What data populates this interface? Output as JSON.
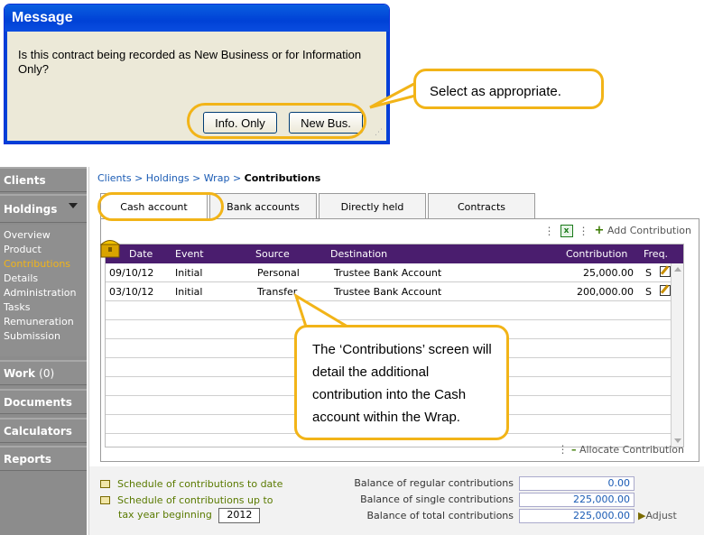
{
  "dialog": {
    "title": "Message",
    "text": "Is this contract being recorded as New Business or for Information Only?",
    "btn_info": "Info. Only",
    "btn_new": "New Bus."
  },
  "callout_top": "Select as appropriate.",
  "callout_mid": "The ‘Contributions’ screen will detail the additional contribution into the Cash account within the Wrap.",
  "nav": {
    "clients": "Clients",
    "holdings": "Holdings",
    "sub": [
      "Overview",
      "Product",
      "Contributions",
      "Details",
      "Administration",
      "Tasks",
      "Remuneration",
      "Submission"
    ],
    "selected_index": 2,
    "work": "Work",
    "work_count": "(0)",
    "documents": "Documents",
    "calculators": "Calculators",
    "reports": "Reports"
  },
  "breadcrumb": {
    "c1": "Clients",
    "c2": "Holdings",
    "c3": "Wrap",
    "current": "Contributions",
    "sep": ">"
  },
  "tabs": [
    "Cash account",
    "Bank accounts",
    "Directly held",
    "Contracts"
  ],
  "active_tab": "Cash account",
  "toolbar": {
    "add": "Add Contribution",
    "excel_icon": "x"
  },
  "table": {
    "headers": {
      "date": "Date",
      "event": "Event",
      "source": "Source",
      "destination": "Destination",
      "contribution": "Contribution",
      "freq": "Freq."
    },
    "rows": [
      {
        "date": "09/10/12",
        "event": "Initial",
        "source": "Personal",
        "destination": "Trustee Bank Account",
        "contribution": "25,000.00",
        "freq": "S"
      },
      {
        "date": "03/10/12",
        "event": "Initial",
        "source": "Transfer",
        "destination": "Trustee Bank Account",
        "contribution": "200,000.00",
        "freq": "S"
      }
    ]
  },
  "allocate": "Allocate Contribution",
  "footer": {
    "link1": "Schedule of contributions to date",
    "link2a": "Schedule of contributions up to",
    "link2b": "tax year beginning",
    "year": "2012",
    "bal_regular_label": "Balance of regular contributions",
    "bal_regular": "0.00",
    "bal_single_label": "Balance of single contributions",
    "bal_single": "225,000.00",
    "bal_total_label": "Balance of total contributions",
    "bal_total": "225,000.00",
    "adjust": "Adjust"
  },
  "colors": {
    "accent": "#f2b418",
    "header": "#4a1d6e",
    "link": "#1a5bb4",
    "nav": "#8c8c8c"
  }
}
